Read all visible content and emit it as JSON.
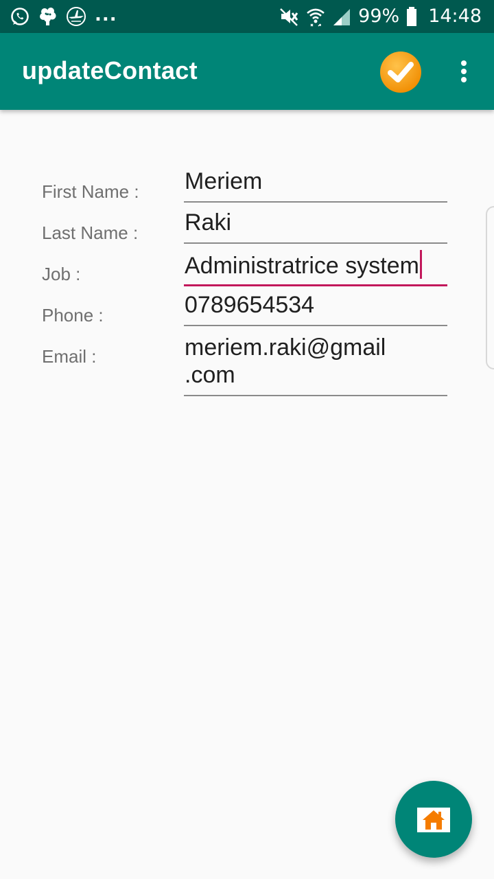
{
  "status_bar": {
    "left_icons": [
      "whatsapp-icon",
      "brain-icon",
      "airplane-logo-icon"
    ],
    "more": "...",
    "right_icons": [
      "mute-icon",
      "wifi-icon",
      "signal-icon",
      "battery-icon"
    ],
    "battery": "99%",
    "time": "14:48"
  },
  "app_bar": {
    "title": "updateContact",
    "save_icon": "check-circle-icon",
    "menu_icon": "overflow-menu-icon",
    "accent_color": "#008577"
  },
  "form": {
    "fields": [
      {
        "label": "First Name :",
        "value": "Meriem"
      },
      {
        "label": "Last Name :",
        "value": "Raki"
      },
      {
        "label": "Job :",
        "value": "Administratrice system"
      },
      {
        "label": "Phone :",
        "value": "0789654534"
      },
      {
        "label": "Email :",
        "value_line1": "meriem.raki@gmail",
        "value_line2": ".com"
      }
    ],
    "focus_color": "#c2185b"
  },
  "fab": {
    "icon": "home-icon",
    "icon_color": "#f57c00"
  }
}
